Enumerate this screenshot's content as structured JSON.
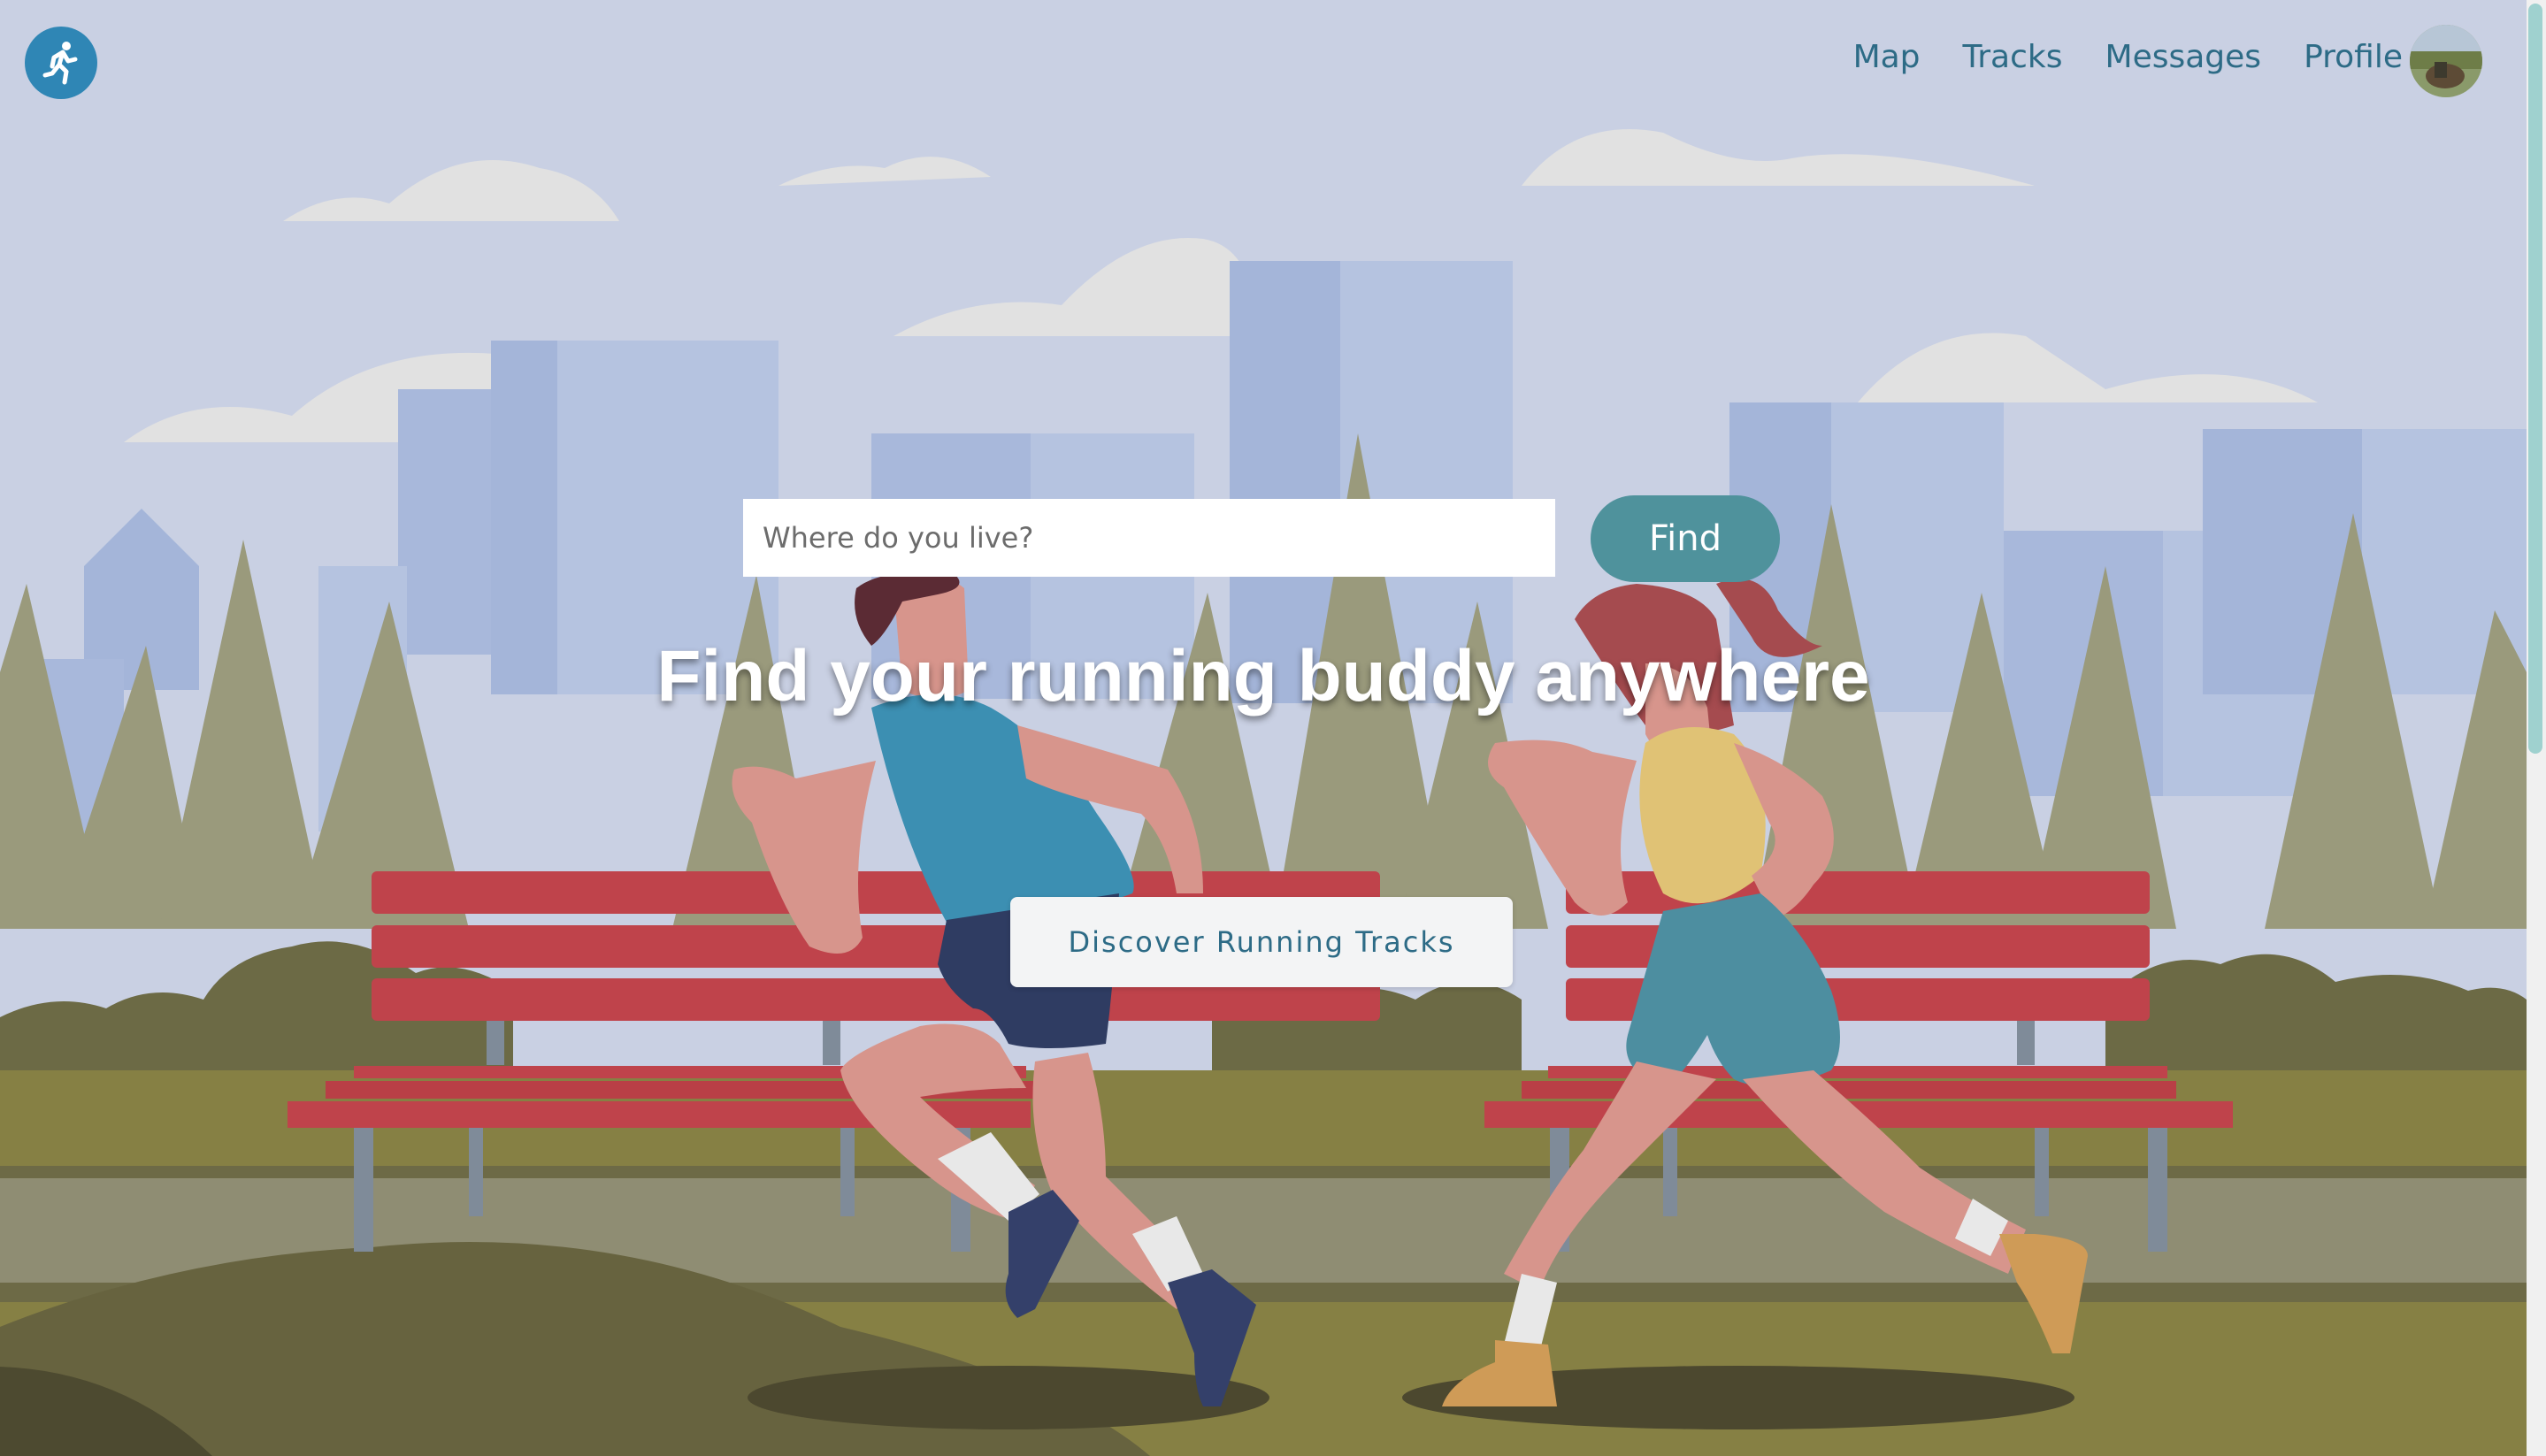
{
  "nav": {
    "logo_icon": "runner-icon",
    "links": [
      "Map",
      "Tracks",
      "Messages",
      "Profile"
    ],
    "avatar_icon": "avatar"
  },
  "search": {
    "placeholder": "Where do you live?",
    "button_label": "Find"
  },
  "hero": {
    "headline": "Find your running buddy anywhere",
    "cta_label": "Discover Running Tracks"
  },
  "colors": {
    "accent": "#4f929c",
    "nav_text": "#2d6b86",
    "logo_bg": "#2f86b5"
  }
}
